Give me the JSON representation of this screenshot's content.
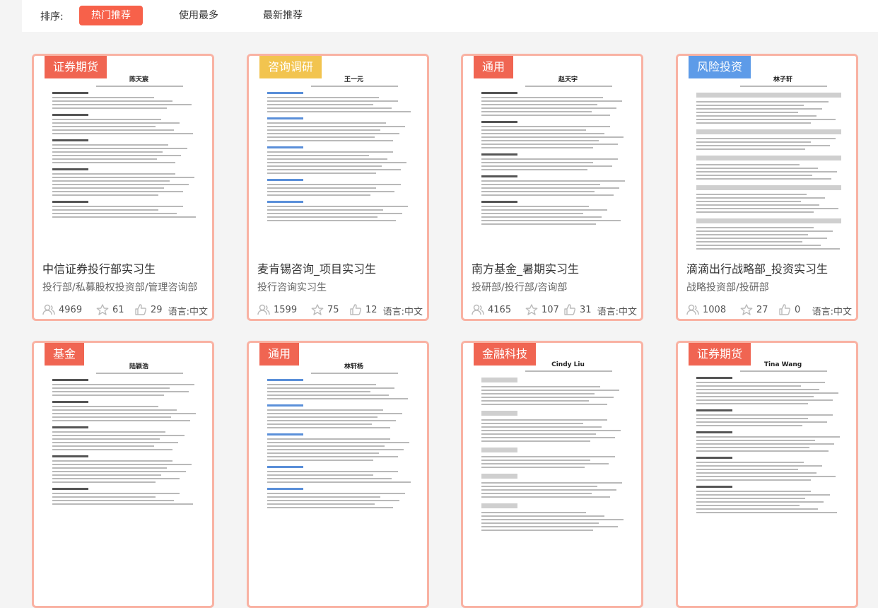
{
  "sort": {
    "label": "排序:",
    "options": [
      "热门推荐",
      "使用最多",
      "最新推荐"
    ],
    "active": "热门推荐"
  },
  "colors": {
    "accent": "#f7614a",
    "tag_red": "#f06552",
    "tag_yellow": "#f2c44f",
    "tag_blue": "#5d9be8",
    "card_border": "#f9b2a3"
  },
  "cards": [
    {
      "tag": "证券期货",
      "tag_color": "#f06552",
      "title": "中信证券投行部实习生",
      "sub": "投行部/私募股权投资部/管理咨询部",
      "views": "4969",
      "stars": "61",
      "likes": "29",
      "lang": "语言:中文",
      "resume_name": "陈天宸"
    },
    {
      "tag": "咨询调研",
      "tag_color": "#f2c44f",
      "title": "麦肯锡咨询_项目实习生",
      "sub": "投行咨询实习生",
      "views": "1599",
      "stars": "75",
      "likes": "12",
      "lang": "语言:中文",
      "resume_name": "王一元"
    },
    {
      "tag": "通用",
      "tag_color": "#f06552",
      "title": "南方基金_暑期实习生",
      "sub": "投研部/投行部/咨询部",
      "views": "4165",
      "stars": "107",
      "likes": "31",
      "lang": "语言:中文",
      "resume_name": "赵天宇"
    },
    {
      "tag": "风险投资",
      "tag_color": "#5d9be8",
      "title": "滴滴出行战略部_投资实习生",
      "sub": "战略投资部/投研部",
      "views": "1008",
      "stars": "27",
      "likes": "0",
      "lang": "语言:中文",
      "resume_name": "林子轩"
    },
    {
      "tag": "基金",
      "tag_color": "#f06552",
      "resume_name": "陆颖浩"
    },
    {
      "tag": "通用",
      "tag_color": "#f06552",
      "resume_name": "林轩杨"
    },
    {
      "tag": "金融科技",
      "tag_color": "#f06552",
      "resume_name": "Cindy Liu"
    },
    {
      "tag": "证券期货",
      "tag_color": "#f06552",
      "resume_name": "Tina Wang"
    }
  ]
}
